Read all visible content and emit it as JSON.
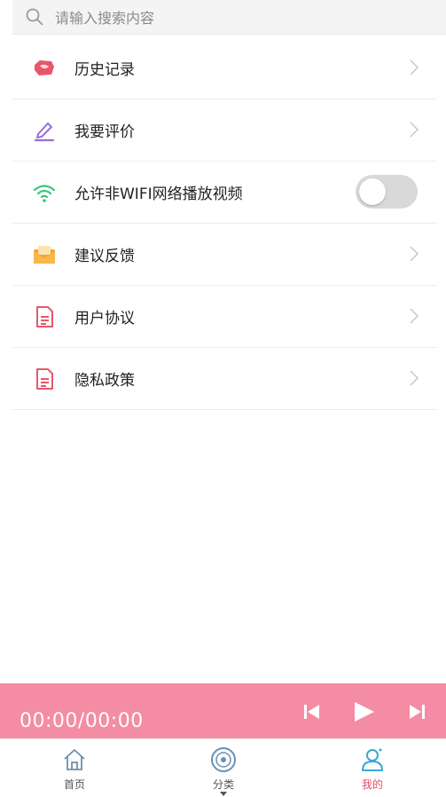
{
  "search": {
    "placeholder": "请输入搜索内容",
    "icon": "search-icon"
  },
  "menu": {
    "items": [
      {
        "label": "历史记录",
        "icon": "history-icon",
        "color": "#e8566c"
      },
      {
        "label": "我要评价",
        "icon": "edit-pencil-icon",
        "color": "#9b6be0"
      },
      {
        "label": "允许非WIFI网络播放视频",
        "icon": "wifi-icon",
        "color": "#36c77a",
        "toggle_on": false
      },
      {
        "label": "建议反馈",
        "icon": "envelope-icon",
        "color": "#f5a623"
      },
      {
        "label": "用户协议",
        "icon": "document-icon",
        "color": "#e8566c"
      },
      {
        "label": "隐私政策",
        "icon": "document-icon",
        "color": "#e8566c"
      }
    ]
  },
  "player": {
    "time": "00:00/00:00",
    "accent": "#f48ca4",
    "controls": [
      "skip-previous-icon",
      "play-icon",
      "skip-next-icon"
    ]
  },
  "tabs": [
    {
      "label": "首页",
      "icon": "home-icon",
      "active": false
    },
    {
      "label": "分类",
      "icon": "disc-icon",
      "active": false
    },
    {
      "label": "我的",
      "icon": "user-icon",
      "active": true,
      "active_color": "#e34b6a"
    }
  ]
}
